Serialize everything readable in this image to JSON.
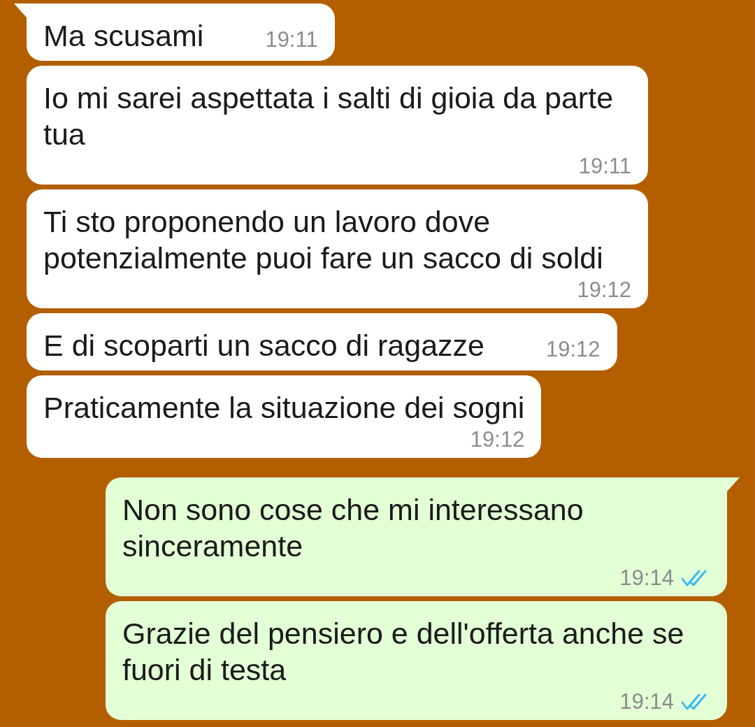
{
  "messages": [
    {
      "kind": "incoming",
      "tail": true,
      "text": "Ma scusami",
      "time": "19:11"
    },
    {
      "kind": "incoming",
      "tail": false,
      "text": "Io mi sarei aspettata i salti di gioia da parte tua",
      "time": "19:11"
    },
    {
      "kind": "incoming",
      "tail": false,
      "text": "Ti sto proponendo un lavoro dove potenzialmente puoi fare un sacco di soldi",
      "time": "19:12"
    },
    {
      "kind": "incoming",
      "tail": false,
      "text": "E di scoparti un sacco di ragazze",
      "time": "19:12"
    },
    {
      "kind": "incoming",
      "tail": false,
      "text": "Praticamente la situazione dei sogni",
      "time": "19:12"
    },
    {
      "kind": "outgoing",
      "tail": true,
      "text": "Non sono cose che mi interessano sinceramente",
      "time": "19:14",
      "read": true
    },
    {
      "kind": "outgoing",
      "tail": false,
      "text": "Grazie del pensiero e dell'offerta anche se fuori di testa",
      "time": "19:14",
      "read": true
    }
  ]
}
